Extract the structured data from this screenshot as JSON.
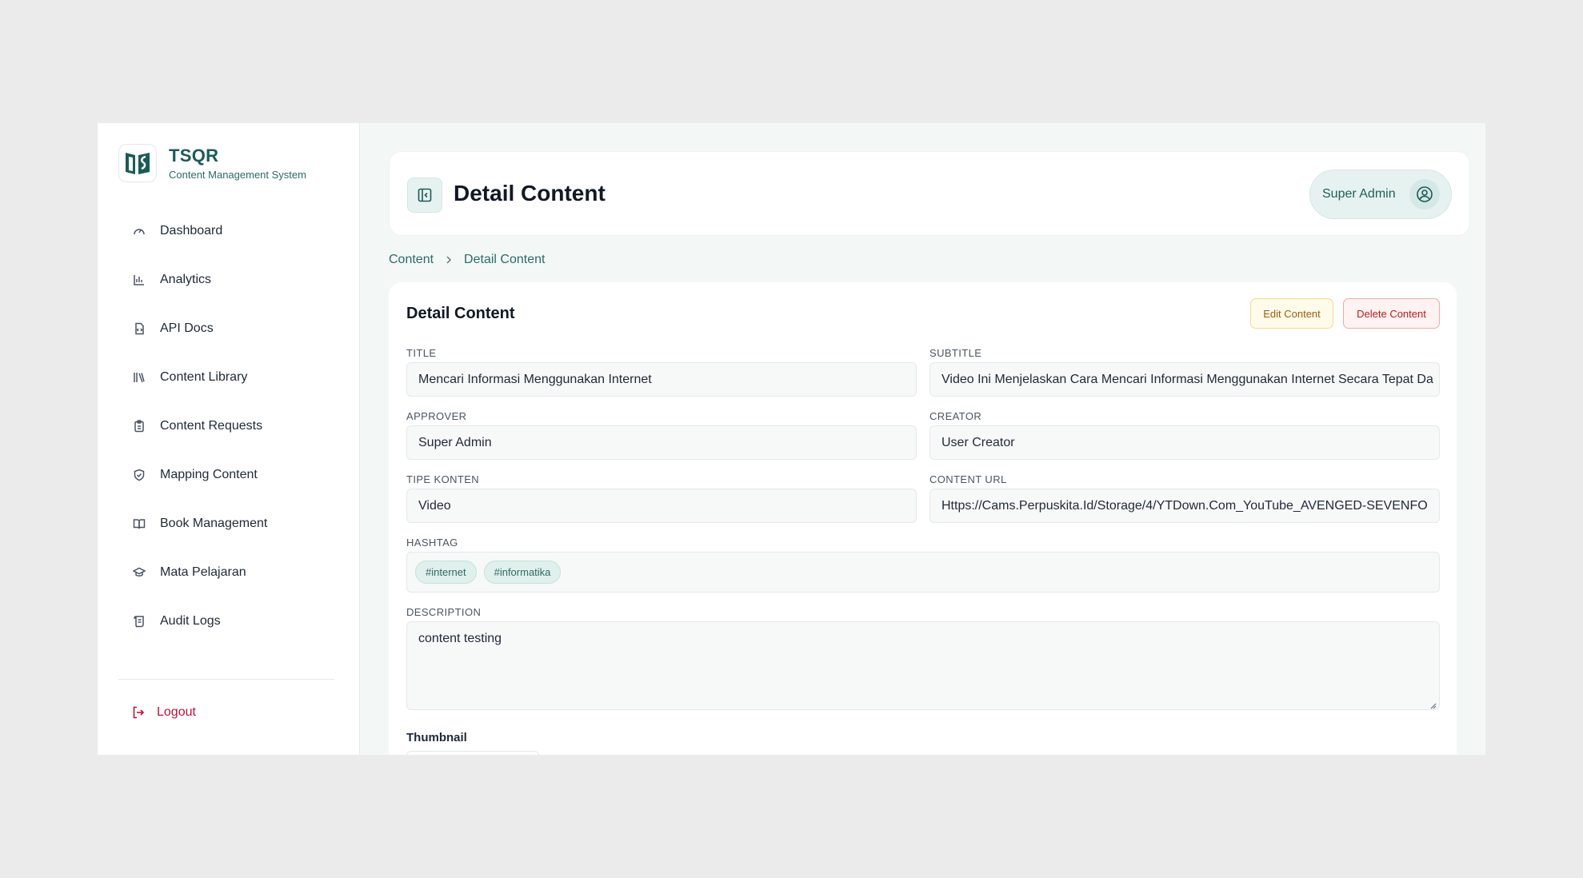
{
  "brand": {
    "name": "TSQR",
    "subtitle": "Content Management System"
  },
  "sidebar": {
    "items": [
      {
        "label": "Dashboard",
        "icon": "gauge-icon"
      },
      {
        "label": "Analytics",
        "icon": "bar-chart-icon"
      },
      {
        "label": "API Docs",
        "icon": "document-code-icon"
      },
      {
        "label": "Content Library",
        "icon": "library-icon"
      },
      {
        "label": "Content Requests",
        "icon": "clipboard-icon"
      },
      {
        "label": "Mapping Content",
        "icon": "shield-check-icon"
      },
      {
        "label": "Book Management",
        "icon": "open-book-icon"
      },
      {
        "label": "Mata Pelajaran",
        "icon": "graduation-cap-icon"
      },
      {
        "label": "Audit Logs",
        "icon": "scroll-icon"
      },
      {
        "label": "",
        "icon": "gauge-icon"
      }
    ],
    "logout_label": "Logout"
  },
  "header": {
    "title": "Detail Content",
    "user_name": "Super Admin"
  },
  "breadcrumb": {
    "parent": "Content",
    "current": "Detail Content"
  },
  "detail": {
    "title": "Detail Content",
    "edit_label": "Edit Content",
    "delete_label": "Delete Content",
    "fields": {
      "title_label": "TITLE",
      "title_value": "Mencari Informasi Menggunakan Internet",
      "subtitle_label": "SUBTITLE",
      "subtitle_value": "Video Ini Menjelaskan Cara Mencari Informasi Menggunakan Internet Secara Tepat Da",
      "approver_label": "APPROVER",
      "approver_value": "Super Admin",
      "creator_label": "CREATOR",
      "creator_value": "User Creator",
      "type_label": "TIPE KONTEN",
      "type_value": "Video",
      "url_label": "CONTENT URL",
      "url_value": "Https://Cams.Perpuskita.Id/Storage/4/YTDown.Com_YouTube_AVENGED-SEVENFO",
      "hashtag_label": "HASHTAG",
      "hashtags": [
        "#internet",
        "#informatika"
      ],
      "description_label": "DESCRIPTION",
      "description_value": "content testing",
      "thumbnail_label": "Thumbnail"
    }
  },
  "colors": {
    "brand": "#1a5c57",
    "accent_bg": "#e6f2f0",
    "logout": "#be123c",
    "edit": "#a15c07",
    "delete": "#b91c1c"
  }
}
